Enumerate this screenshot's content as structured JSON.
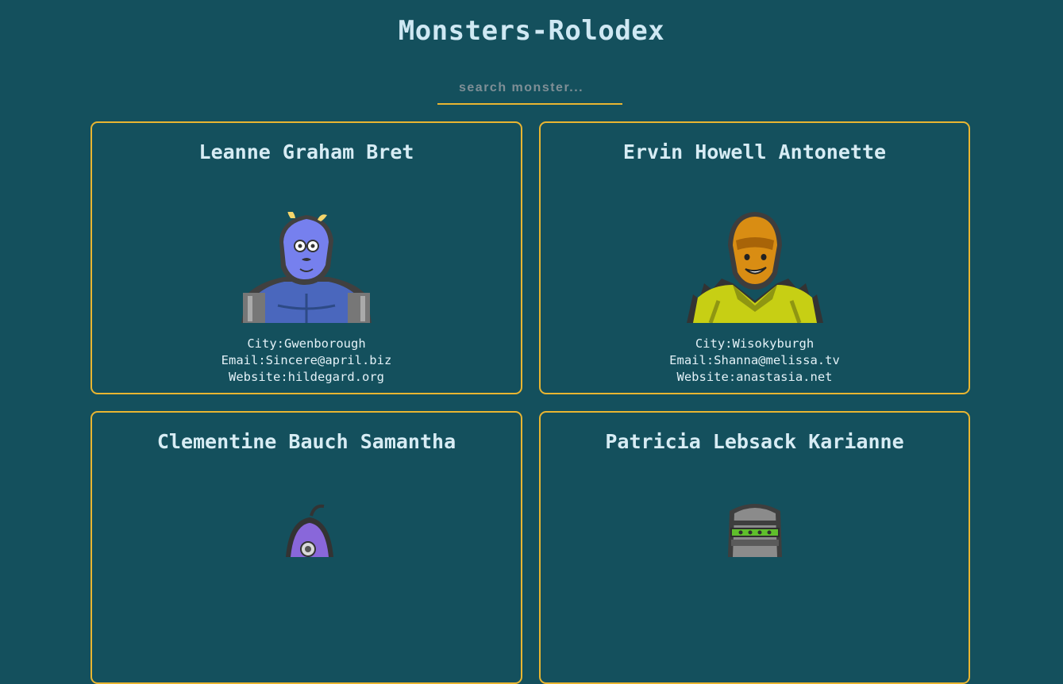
{
  "app": {
    "title": "Monsters-Rolodex"
  },
  "search": {
    "placeholder": "search monster..."
  },
  "monsters": [
    {
      "name": "Leanne Graham Bret",
      "avatar_icon": "blue-monster-avatar-icon",
      "city_label": "City:Gwenborough",
      "email_label": "Email:Sincere@april.biz",
      "website_label": "Website:hildegard.org"
    },
    {
      "name": "Ervin Howell Antonette",
      "avatar_icon": "orange-monster-avatar-icon",
      "city_label": "City:Wisokyburgh",
      "email_label": "Email:Shanna@melissa.tv",
      "website_label": "Website:anastasia.net"
    },
    {
      "name": "Clementine Bauch Samantha",
      "avatar_icon": "purple-monster-avatar-icon"
    },
    {
      "name": "Patricia Lebsack Karianne",
      "avatar_icon": "robot-monster-avatar-icon"
    }
  ],
  "colors": {
    "background": "#14505d",
    "accent_border": "#e9b531",
    "text": "#d7ecf4"
  }
}
